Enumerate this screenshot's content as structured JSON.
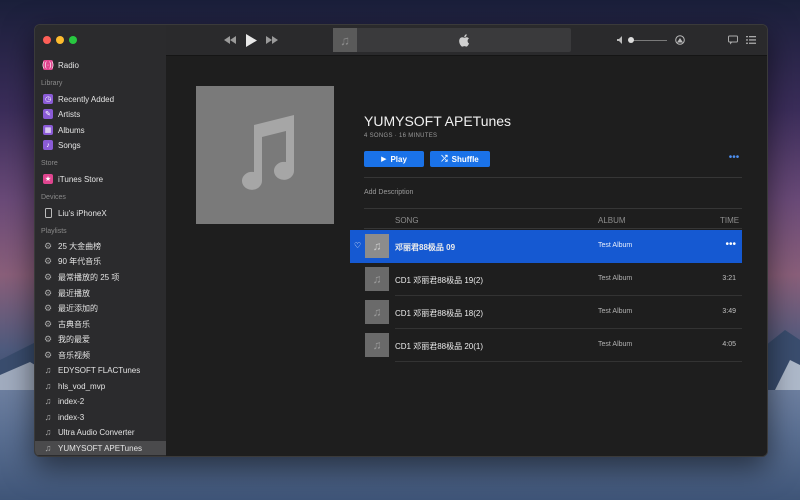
{
  "sidebar": {
    "radio": "Radio",
    "library_header": "Library",
    "library": [
      "Recently Added",
      "Artists",
      "Albums",
      "Songs"
    ],
    "store_header": "Store",
    "store": "iTunes Store",
    "devices_header": "Devices",
    "device": "Liu's iPhoneX",
    "playlists_header": "Playlists",
    "smart_playlists": [
      "25 大金曲榜",
      "90 年代音乐",
      "最常播放的 25 项",
      "最近播放",
      "最近添加的",
      "古典音乐",
      "我的最爱",
      "音乐视频"
    ],
    "playlists": [
      "EDYSOFT FLACTunes",
      "hls_vod_mvp",
      "index-2",
      "index-3",
      "Ultra Audio Converter",
      "YUMYSOFT APETunes"
    ]
  },
  "album": {
    "title": "YUMYSOFT APETunes",
    "subtitle": "4 SONGS · 16 MINUTES",
    "play_label": "Play",
    "shuffle_label": "Shuffle",
    "add_description": "Add Description"
  },
  "columns": {
    "song": "SONG",
    "album": "ALBUM",
    "time": "TIME"
  },
  "songs": [
    {
      "title": "邓丽君88极品 09",
      "album": "Test Album",
      "time": ""
    },
    {
      "title": "CD1 邓丽君88极品 19(2)",
      "album": "Test Album",
      "time": "3:21"
    },
    {
      "title": "CD1 邓丽君88极品 18(2)",
      "album": "Test Album",
      "time": "3:49"
    },
    {
      "title": "CD1 邓丽君88极品 20(1)",
      "album": "Test Album",
      "time": "4:05"
    }
  ],
  "colors": {
    "accent": "#1a72e8",
    "selected_row": "#1559d2",
    "radio_pink": "#e0458f"
  }
}
